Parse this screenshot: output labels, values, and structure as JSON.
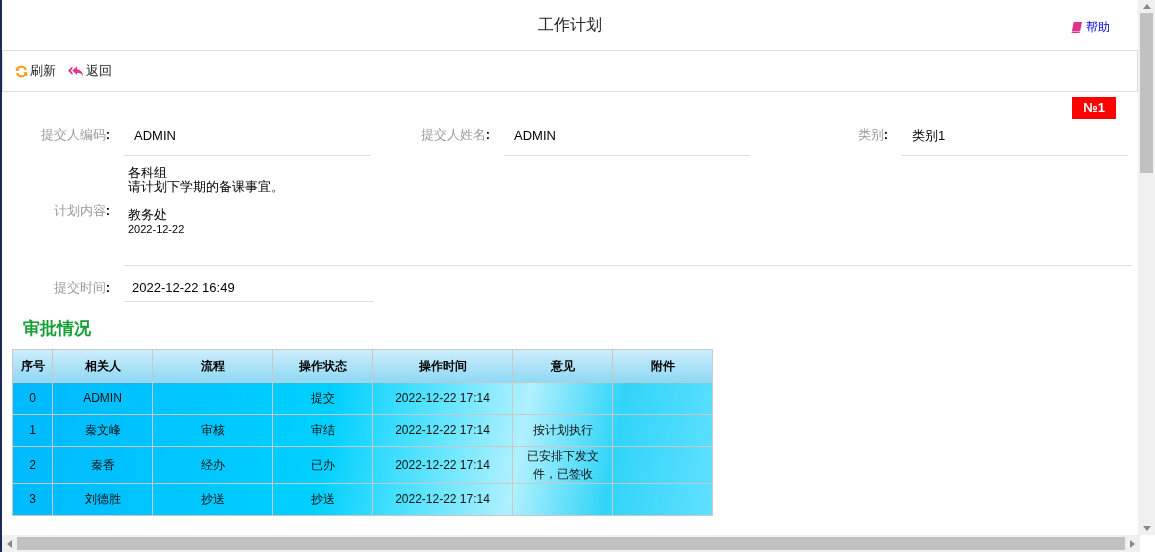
{
  "page": {
    "title": "工作计划",
    "help": "帮助"
  },
  "toolbar": [
    {
      "label": "刷新",
      "kind": "refresh"
    },
    {
      "label": "返回",
      "kind": "back"
    }
  ],
  "badge": "№1",
  "form": {
    "fields": [
      {
        "label": "提交人编码**:**",
        "value": "ADMIN"
      },
      {
        "label": "提交人姓名**:**",
        "value": "ADMIN"
      },
      {
        "label": "类别**:**",
        "value": "类别1"
      }
    ],
    "content": {
      "label": "计划内容**:**",
      "lines": [
        "各科组",
        "请计划下学期的备课事宜。"
      ],
      "signature": "教务处",
      "date": "2022-12-22"
    },
    "submit_time": {
      "label": "提交时间**:**",
      "value": "2022-12-22 16:49"
    }
  },
  "approval": {
    "title": "审批情况",
    "columns": [
      "序号",
      "相关人",
      "流程",
      "操作状态",
      "操作时间",
      "意见",
      "附件"
    ],
    "rows": [
      [
        "0",
        "ADMIN",
        "",
        "提交",
        "2022-12-22 17:14",
        "",
        ""
      ],
      [
        "1",
        "秦文峰",
        "审核",
        "审结",
        "2022-12-22 17:14",
        "按计划执行",
        ""
      ],
      [
        "2",
        "秦香",
        "经办",
        "已办",
        "2022-12-22 17:14",
        "已安排下发文件，已签收",
        ""
      ],
      [
        "3",
        "刘德胜",
        "抄送",
        "抄送",
        "2022-12-22 17:14",
        "",
        ""
      ]
    ]
  }
}
